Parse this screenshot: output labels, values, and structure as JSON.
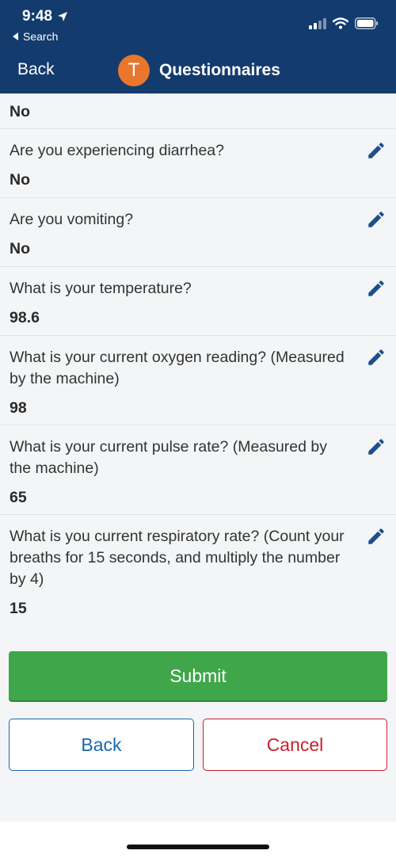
{
  "status_bar": {
    "time": "9:48",
    "back_app": "Search"
  },
  "nav": {
    "back_label": "Back",
    "avatar_letter": "T",
    "title": "Questionnaires"
  },
  "first_answer": "No",
  "questions": [
    {
      "question": "Are you experiencing diarrhea?",
      "answer": "No"
    },
    {
      "question": "Are you vomiting?",
      "answer": "No"
    },
    {
      "question": "What is your temperature?",
      "answer": "98.6"
    },
    {
      "question": "What is your current oxygen reading? (Measured by the machine)",
      "answer": "98"
    },
    {
      "question": "What is your current pulse rate? (Measured by the machine)",
      "answer": "65"
    },
    {
      "question": "What is you current respiratory rate? (Count your breaths for 15 seconds, and multiply the number by 4)",
      "answer": "15"
    }
  ],
  "buttons": {
    "submit": "Submit",
    "back": "Back",
    "cancel": "Cancel"
  },
  "colors": {
    "header": "#143b6e",
    "avatar": "#e8762c",
    "submit": "#3fa74a",
    "back": "#1b66b0",
    "cancel": "#c8202a"
  }
}
